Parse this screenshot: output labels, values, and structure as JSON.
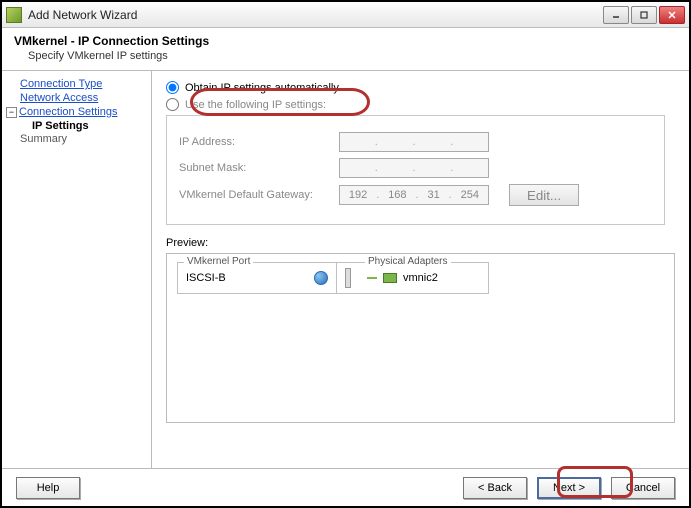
{
  "window": {
    "title": "Add Network Wizard"
  },
  "header": {
    "title": "VMkernel - IP Connection Settings",
    "subtitle": "Specify VMkernel IP settings"
  },
  "sidebar": {
    "items": [
      {
        "label": "Connection Type",
        "type": "link"
      },
      {
        "label": "Network Access",
        "type": "link"
      },
      {
        "label": "Connection Settings",
        "type": "link-expandable",
        "expanded": true
      },
      {
        "label": "IP Settings",
        "type": "current"
      },
      {
        "label": "Summary",
        "type": "plain"
      }
    ]
  },
  "options": {
    "auto_label": "Obtain IP settings automatically",
    "manual_label": "Use the following IP settings:",
    "selected": "auto"
  },
  "fields": {
    "ip_label": "IP Address:",
    "ip_value": [
      "",
      "",
      "",
      ""
    ],
    "mask_label": "Subnet Mask:",
    "mask_value": [
      "",
      "",
      "",
      ""
    ],
    "gw_label": "VMkernel Default Gateway:",
    "gw_value": [
      "192",
      "168",
      "31",
      "254"
    ],
    "edit_label": "Edit..."
  },
  "preview": {
    "section_label": "Preview:",
    "vmk_legend": "VMkernel Port",
    "vmk_name": "ISCSI-B",
    "phys_legend": "Physical Adapters",
    "phys_name": "vmnic2"
  },
  "footer": {
    "help": "Help",
    "back": "< Back",
    "next": "Next >",
    "cancel": "Cancel"
  }
}
